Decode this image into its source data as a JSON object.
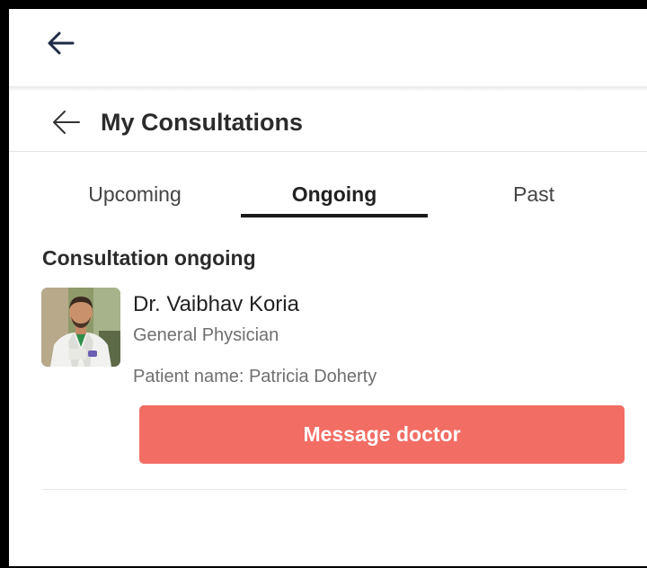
{
  "header": {
    "title": "My Consultations"
  },
  "tabs": [
    {
      "label": "Upcoming",
      "active": false
    },
    {
      "label": "Ongoing",
      "active": true
    },
    {
      "label": "Past",
      "active": false
    }
  ],
  "section": {
    "title": "Consultation ongoing"
  },
  "consultation": {
    "doctor_name": "Dr. Vaibhav Koria",
    "specialty": "General Physician",
    "patient_line": "Patient name: Patricia Doherty",
    "action_label": "Message doctor"
  },
  "icons": {
    "top_back": "arrow-left-icon",
    "header_back": "arrow-left-icon"
  },
  "colors": {
    "accent": "#f26d63",
    "title_text": "#2b2b2b",
    "secondary_text": "#6f6f6f",
    "tab_underline": "#1a1a1a"
  }
}
